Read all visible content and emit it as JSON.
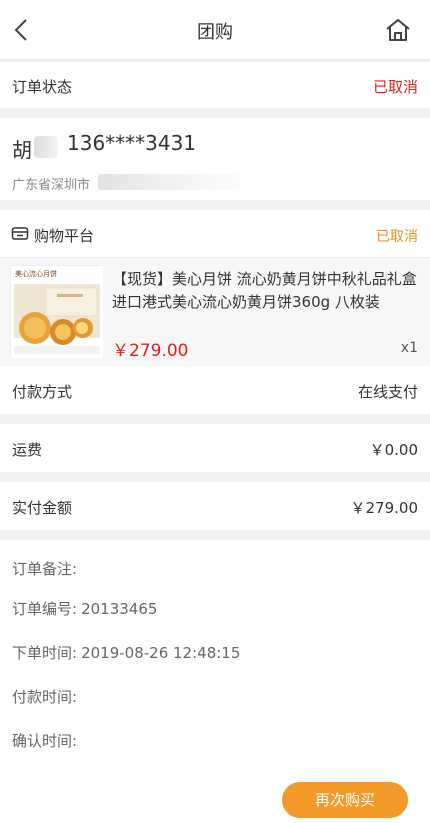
{
  "header": {
    "title": "团购",
    "back_icon": "chevron-left-icon",
    "home_icon": "home-icon"
  },
  "order_status": {
    "label": "订单状态",
    "value": "已取消",
    "value_color": "#e02020"
  },
  "address": {
    "name": "胡",
    "phone": "136****3431",
    "address": "广东省深圳市"
  },
  "shop": {
    "icon": "store-icon",
    "name": "购物平台",
    "status": "已取消",
    "status_color": "#f08a1c"
  },
  "product": {
    "thumb_label": "美心流心月饼",
    "name": "【现货】美心月饼 流心奶黄月饼中秋礼品礼盒 进口港式美心流心奶黄月饼360g 八枚装",
    "price": "￥279.00",
    "quantity": "x1"
  },
  "payment": {
    "label": "付款方式",
    "value": "在线支付"
  },
  "shipping": {
    "label": "运费",
    "value": "￥0.00"
  },
  "paid": {
    "label": "实付金额",
    "value": "￥279.00"
  },
  "info": {
    "remark_label": "订单备注:",
    "remark_value": "",
    "order_no_label": "订单编号:",
    "order_no_value": "20133465",
    "order_time_label": "下单时间:",
    "order_time_value": "2019-08-26 12:48:15",
    "pay_time_label": "付款时间:",
    "pay_time_value": "",
    "confirm_time_label": "确认时间:",
    "confirm_time_value": ""
  },
  "actions": {
    "rebuy_label": "再次购买",
    "rebuy_color": "#f39a2b"
  }
}
